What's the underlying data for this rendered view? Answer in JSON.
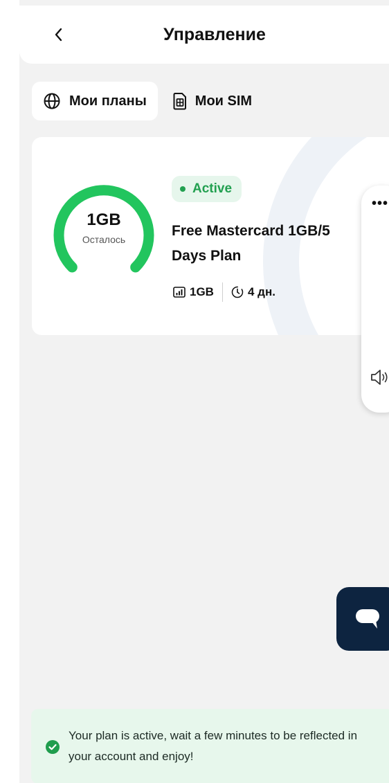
{
  "header": {
    "title": "Управление",
    "back_icon": "chevron-left-icon"
  },
  "tabs": [
    {
      "label": "Мои планы",
      "icon": "globe-icon",
      "active": true
    },
    {
      "label": "Мои SIM",
      "icon": "sim-card-icon",
      "active": false
    }
  ],
  "plan": {
    "status": "Active",
    "status_color": "#22a050",
    "name_line1": "Free Mastercard 1GB/5",
    "name_line2": "Days Plan",
    "gauge_value": "1GB",
    "gauge_label": "Осталось",
    "gauge_fill_fraction": 1.0,
    "gauge_color": "#22c55e",
    "data_amount": "1GB",
    "data_icon": "signal-icon",
    "validity": "4 дн.",
    "validity_icon": "clock-icon"
  },
  "side_panel": {
    "menu_label": "•••",
    "volume_icon": "speaker-icon"
  },
  "chat": {
    "icon": "chat-bubble-icon",
    "bg_color": "#0d2440"
  },
  "toast": {
    "icon": "check-circle-icon",
    "text": "Your plan is active, wait a few minutes to be reflected in your account and enjoy!",
    "bg_color": "#e7f7ec"
  }
}
